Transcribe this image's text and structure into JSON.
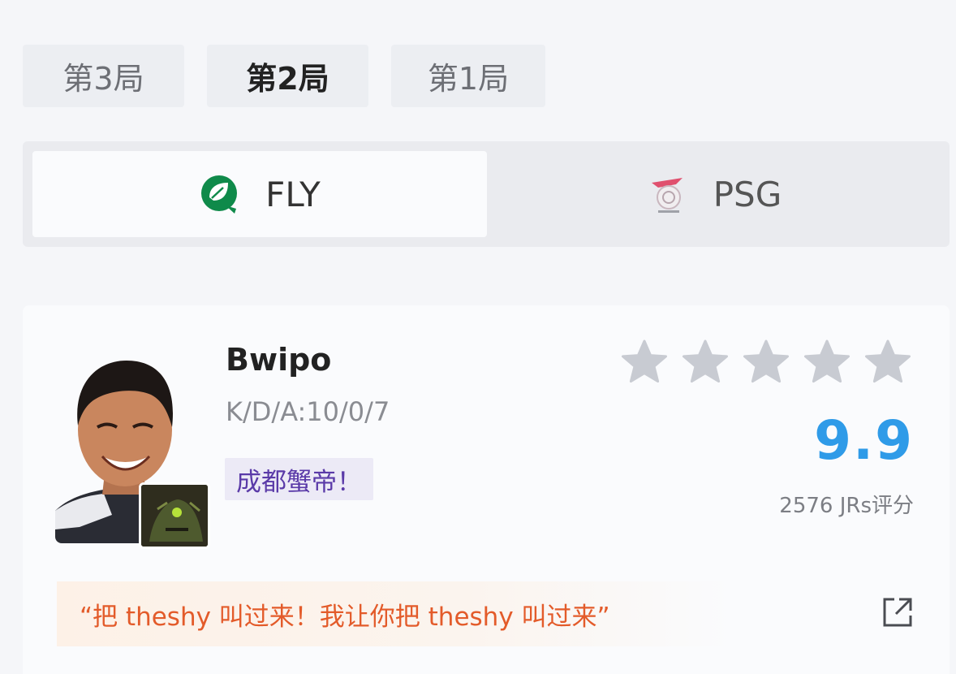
{
  "game_tabs": [
    "第3局",
    "第2局",
    "第1局"
  ],
  "active_game_tab": "第2局",
  "teams": {
    "left": {
      "name": "FLY",
      "logo": "fly-leaf-logo",
      "color": "#0f8a4a"
    },
    "right": {
      "name": "PSG",
      "logo": "psg-logo",
      "color": "#e0506e"
    }
  },
  "player": {
    "name": "Bwipo",
    "kda": "K/D/A:10/0/7",
    "nickname_tag": "成都蟹帝！",
    "rating_stars": 5,
    "score": "9.9",
    "raters": "2576 JRs评分",
    "quote": "“把 theshy 叫过来！我让你把 theshy 叫过来”"
  },
  "colors": {
    "score": "#2f9be8",
    "quote": "#e35b2a",
    "tag_text": "#5a3aa8",
    "star_empty": "#c8cbd2"
  }
}
